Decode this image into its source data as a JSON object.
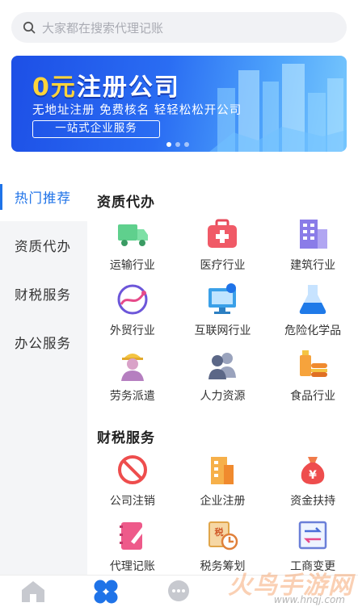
{
  "search": {
    "placeholder": "大家都在搜索代理记账"
  },
  "banner": {
    "title_accent": "0元",
    "title_rest": "注册公司",
    "subtitle": "无地址注册  免费核名  轻轻松松开公司",
    "tag": "一站式企业服务"
  },
  "sidebar": {
    "items": [
      {
        "label": "热门推荐"
      },
      {
        "label": "资质代办"
      },
      {
        "label": "财税服务"
      },
      {
        "label": "办公服务"
      }
    ]
  },
  "sections": [
    {
      "title": "资质代办",
      "items": [
        {
          "label": "运输行业",
          "icon": "truck-icon"
        },
        {
          "label": "医疗行业",
          "icon": "medical-kit-icon"
        },
        {
          "label": "建筑行业",
          "icon": "building-icon"
        },
        {
          "label": "外贸行业",
          "icon": "globe-trade-icon"
        },
        {
          "label": "互联网行业",
          "icon": "computer-icon"
        },
        {
          "label": "危险化学品",
          "icon": "flask-icon"
        },
        {
          "label": "劳务派遣",
          "icon": "worker-icon"
        },
        {
          "label": "人力资源",
          "icon": "people-icon"
        },
        {
          "label": "食品行业",
          "icon": "food-icon"
        }
      ]
    },
    {
      "title": "财税服务",
      "items": [
        {
          "label": "公司注销",
          "icon": "cancel-icon"
        },
        {
          "label": "企业注册",
          "icon": "office-building-icon"
        },
        {
          "label": "资金扶持",
          "icon": "money-bag-icon"
        },
        {
          "label": "代理记账",
          "icon": "notebook-pen-icon"
        },
        {
          "label": "税务筹划",
          "icon": "tax-plan-icon"
        },
        {
          "label": "工商变更",
          "icon": "change-icon"
        }
      ]
    }
  ],
  "tabbar": [
    {
      "icon": "home-icon"
    },
    {
      "icon": "category-icon"
    },
    {
      "icon": "message-icon"
    }
  ],
  "watermark": {
    "text": "火鸟手游网",
    "url": "www.hnqj.com"
  },
  "colors": {
    "accent": "#1f73e8",
    "sidebar_bg": "#f4f5f7"
  }
}
